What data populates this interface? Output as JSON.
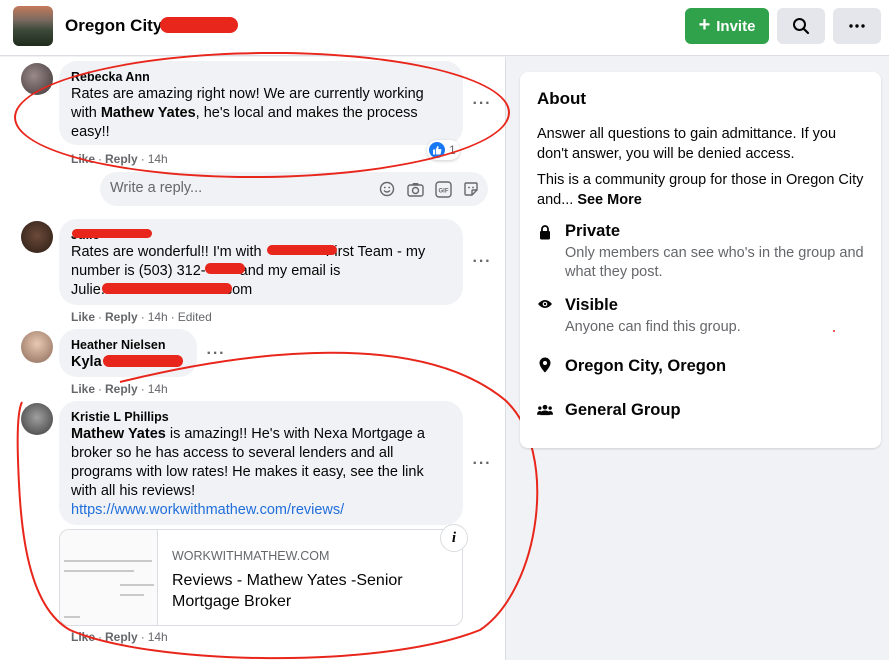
{
  "header": {
    "group_name": "Oregon City",
    "invite_label": "Invite",
    "search_icon": "search-icon",
    "more_icon": "more-icon"
  },
  "comments": [
    {
      "author": "Rebecka Ann",
      "text_parts": [
        "Rates are amazing right now! We are currently working with ",
        "Mathew Yates",
        ", he's local and makes the process easy!!"
      ],
      "actions": {
        "like": "Like",
        "reply": "Reply",
        "time": "14h"
      },
      "reaction_count": "1"
    },
    {
      "author": "Julie",
      "text": "Rates are wonderful!! I'm with First Team - my number is (503) 312- and my email is Julie. com",
      "line1": "Rates are wonderful!! I'm with",
      "line1b": "First Team - my",
      "line2a": "number is (503) 312-",
      "line2b": "and my email is",
      "line3a": "Julie.",
      "line3b": "com",
      "actions": {
        "like": "Like",
        "reply": "Reply",
        "time": "14h",
        "edited": "Edited"
      }
    },
    {
      "author": "Heather Nielsen",
      "text": "Kyla",
      "actions": {
        "like": "Like",
        "reply": "Reply",
        "time": "14h"
      }
    },
    {
      "author": "Kristie L Phillips",
      "mention": "Mathew Yates",
      "text": " is amazing!! He's with Nexa Mortgage a broker so he has access to several lenders and all programs with low rates! He makes it easy, see the link with all his reviews!",
      "link": "https://www.workwithmathew.com/reviews/",
      "actions": {
        "like": "Like",
        "reply": "Reply",
        "time": "14h"
      },
      "preview": {
        "domain": "WORKWITHMATHEW.COM",
        "title": "Reviews - Mathew Yates -Senior Mortgage Broker"
      }
    }
  ],
  "reply_box": {
    "placeholder": "Write a reply..."
  },
  "about": {
    "title": "About",
    "description1": "Answer all questions to gain admittance. If you don't answer, you will be denied access.",
    "description2": "This is a community group for those in Oregon City and...",
    "see_more": "See More",
    "private_title": "Private",
    "private_sub": "Only members can see who's in the group and what they post.",
    "visible_title": "Visible",
    "visible_sub": "Anyone can find this group.",
    "location": "Oregon City, Oregon",
    "group_type": "General Group"
  },
  "colors": {
    "invite_green": "#31a24c",
    "link_blue": "#216fdb",
    "annotation_red": "#e8261b"
  }
}
